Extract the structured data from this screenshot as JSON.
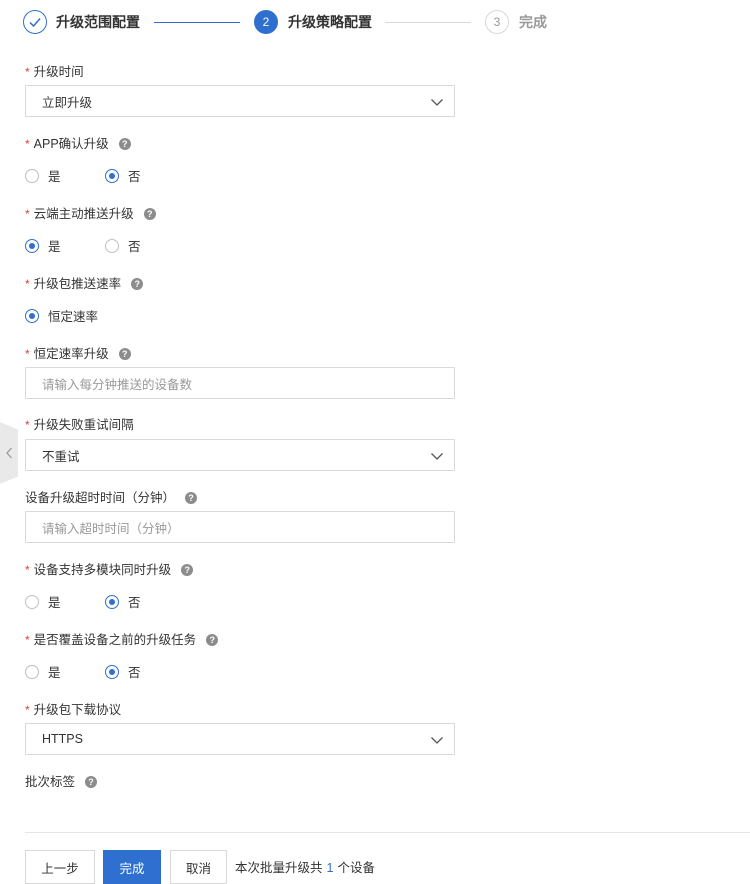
{
  "stepper": {
    "steps": [
      {
        "label": "升级范围配置",
        "number": "",
        "state": "completed"
      },
      {
        "label": "升级策略配置",
        "number": "2",
        "state": "active"
      },
      {
        "label": "完成",
        "number": "3",
        "state": "pending"
      }
    ]
  },
  "form": {
    "upgrade_time": {
      "label": "升级时间",
      "value": "立即升级"
    },
    "app_confirm": {
      "label": "APP确认升级",
      "options": [
        "是",
        "否"
      ],
      "selected": "否"
    },
    "cloud_push": {
      "label": "云端主动推送升级",
      "options": [
        "是",
        "否"
      ],
      "selected": "是"
    },
    "push_rate": {
      "label": "升级包推送速率",
      "options": [
        "恒定速率"
      ],
      "selected": "恒定速率"
    },
    "constant_rate": {
      "label": "恒定速率升级",
      "placeholder": "请输入每分钟推送的设备数"
    },
    "retry_interval": {
      "label": "升级失败重试间隔",
      "value": "不重试"
    },
    "timeout": {
      "label": "设备升级超时时间（分钟）",
      "placeholder": "请输入超时时间（分钟）"
    },
    "multi_module": {
      "label": "设备支持多模块同时升级",
      "options": [
        "是",
        "否"
      ],
      "selected": "否"
    },
    "override_tasks": {
      "label": "是否覆盖设备之前的升级任务",
      "options": [
        "是",
        "否"
      ],
      "selected": "否"
    },
    "download_protocol": {
      "label": "升级包下载协议",
      "value": "HTTPS"
    },
    "batch_tag": {
      "label": "批次标签"
    }
  },
  "footer": {
    "prev_label": "上一步",
    "done_label": "完成",
    "cancel_label": "取消",
    "note_prefix": "本次批量升级共",
    "device_count": "1",
    "note_suffix": "个设备"
  },
  "icons": {
    "help": "question-mark-icon",
    "dropdown": "chevron-down-icon",
    "step_done": "check-icon",
    "collapse": "chevron-left-icon"
  },
  "colors": {
    "primary": "#2f6fd0",
    "required": "#e23c39",
    "border": "#d9d9d9"
  }
}
